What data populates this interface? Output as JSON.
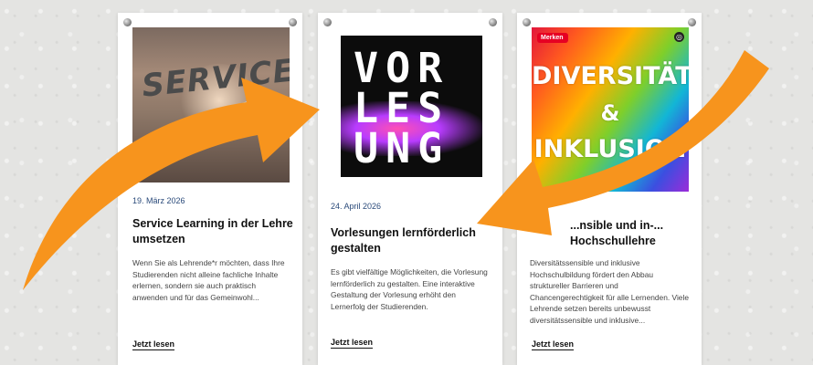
{
  "cards": [
    {
      "date": "19. März 2026",
      "title": "Service Learning in der Lehre umsetzen",
      "excerpt": "Wenn Sie als Lehrende*r möchten, dass Ihre Studierenden nicht alleine fachliche Inhalte erlernen, sondern sie auch praktisch anwenden und für das Gemeinwohl...",
      "link": "Jetzt lesen",
      "image_text": "SERVICE"
    },
    {
      "date": "24. April 2026",
      "title": "Vorlesungen lernförderlich gestalten",
      "excerpt": "Es gibt vielfältige Möglichkeiten, die Vorlesung lernförderlich zu gestalten. Eine interaktive Gestaltung der Vorlesung erhöht den Lernerfolg der Studierenden.",
      "link": "Jetzt lesen",
      "image_lines": [
        "VOR",
        "LES",
        "UNG"
      ]
    },
    {
      "title": "...nsible und in-... Hochschullehre",
      "excerpt": "Diversitätssensible und inklusive Hochschulbildung fördert den Abbau struktureller Barrieren und Chancengerechtigkeit für alle Lernenden. Viele Lehrende setzen bereits unbewusst diversitätssensible und inklusive...",
      "link": "Jetzt lesen",
      "image_lines": [
        "DIVERSITÄT",
        "&",
        "INKLUSION"
      ],
      "save_badge": "Merken"
    }
  ],
  "colors": {
    "arrow": "#f7941d",
    "date": "#2a4a7a",
    "pin_badge": "#e60023"
  }
}
